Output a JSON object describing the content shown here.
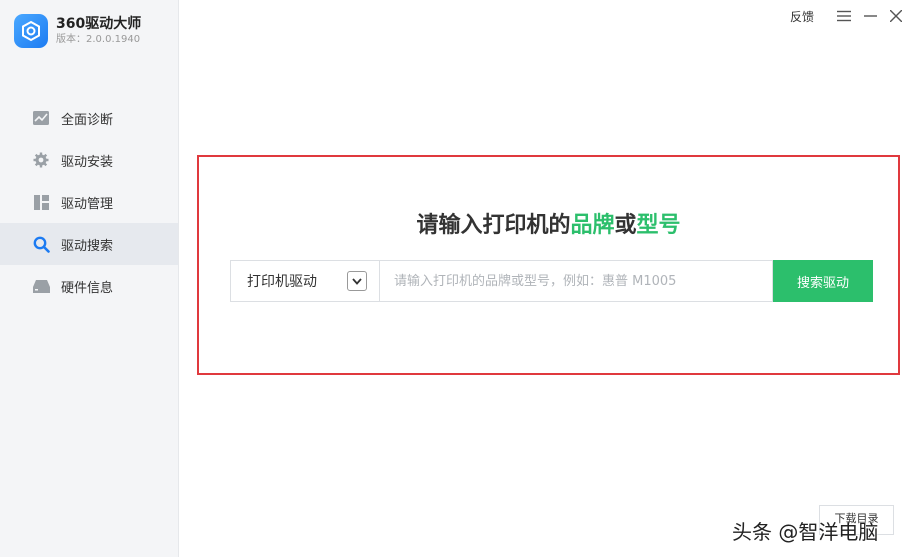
{
  "app": {
    "title": "360驱动大师",
    "version_label": "版本：",
    "version": "2.0.0.1940",
    "accent": "#1c7bf2"
  },
  "topbar": {
    "feedback_label": "反馈",
    "menu_icon": "hamburger-icon",
    "minimize_icon": "minimize-icon",
    "close_icon": "close-icon"
  },
  "sidebar": {
    "items": [
      {
        "label": "全面诊断",
        "icon": "chart-icon"
      },
      {
        "label": "驱动安装",
        "icon": "gear-icon"
      },
      {
        "label": "驱动管理",
        "icon": "grid-icon"
      },
      {
        "label": "驱动搜索",
        "icon": "search-icon",
        "active": true
      },
      {
        "label": "硬件信息",
        "icon": "hard-drive-icon"
      }
    ]
  },
  "search_panel": {
    "headline_prefix": "请输入打印机的",
    "headline_brand": "品牌",
    "headline_or": "或",
    "headline_model": "型号",
    "highlight_color": "#2cbf6c",
    "border_color": "#e0393e",
    "category_selected": "打印机驱动",
    "input_value": "",
    "input_placeholder": "请输入打印机的品牌或型号，例如：惠普 M1005",
    "search_button_label": "搜索驱动"
  },
  "footer": {
    "download_dir_label": "下载目录",
    "watermark": "头条 @智洋电脑"
  }
}
